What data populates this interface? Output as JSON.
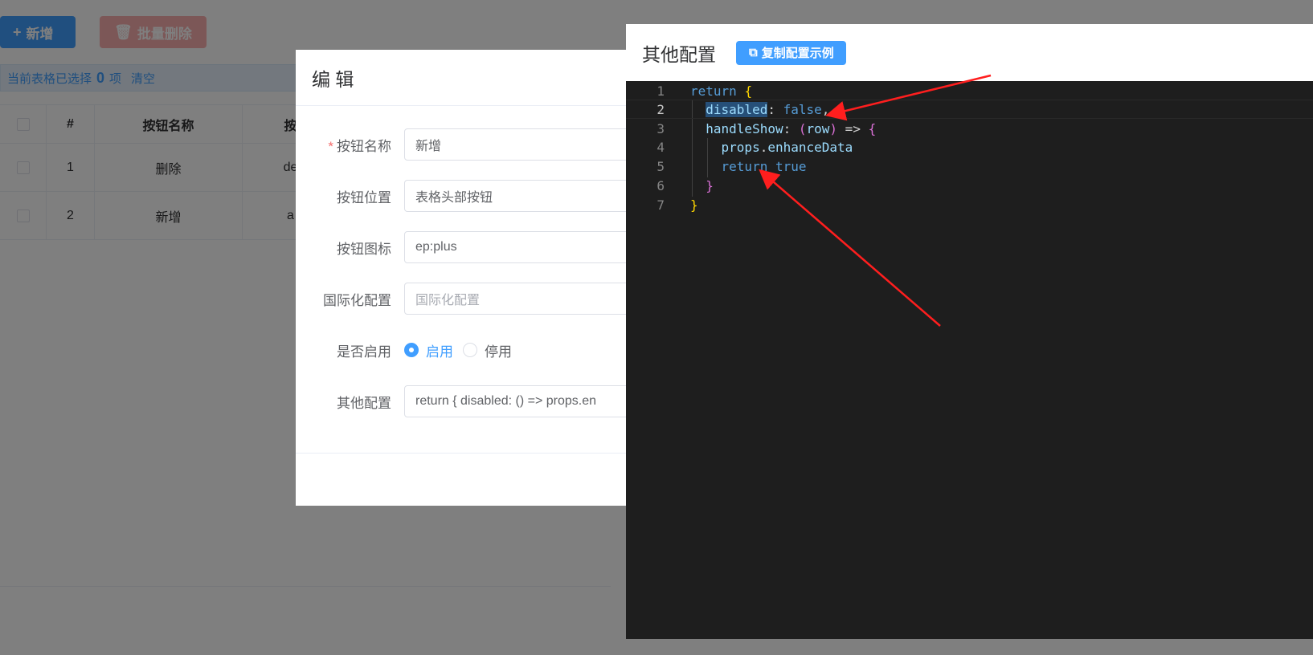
{
  "toolbar": {
    "add_label": "新增",
    "batch_delete_label": "批量删除"
  },
  "selection": {
    "prefix": "当前表格已选择",
    "count": "0",
    "suffix": "项",
    "clear_label": "清空"
  },
  "table": {
    "headers": [
      "#",
      "按钮名称",
      "按"
    ],
    "rows": [
      {
        "index": "1",
        "name": "删除",
        "code": "de"
      },
      {
        "index": "2",
        "name": "新增",
        "code": "a"
      }
    ]
  },
  "edit_dialog": {
    "title": "编 辑",
    "fields": {
      "button_name": {
        "label": "按钮名称",
        "value": "新增"
      },
      "button_position": {
        "label": "按钮位置",
        "value": "表格头部按钮"
      },
      "button_icon": {
        "label": "按钮图标",
        "value": "ep:plus"
      },
      "i18n": {
        "label": "国际化配置",
        "placeholder": "国际化配置"
      },
      "enabled": {
        "label": "是否启用",
        "options": [
          "启用",
          "停用"
        ],
        "selected": "启用"
      },
      "other_config": {
        "label": "其他配置",
        "value": "return {  disabled: () => props.en"
      }
    }
  },
  "code_dialog": {
    "title": "其他配置",
    "copy_button_label": "复制配置示例",
    "line_numbers": [
      "1",
      "2",
      "3",
      "4",
      "5",
      "6",
      "7"
    ],
    "code_lines": [
      "return {",
      "  disabled: false,",
      "  handleShow: (row) => {",
      "    props.enhanceData",
      "    return true",
      "  }",
      "}"
    ]
  },
  "colors": {
    "primary": "#409eff",
    "danger": "#f56c6c",
    "editor_bg": "#1e1e1e",
    "arrow": "#ff1e1e"
  }
}
